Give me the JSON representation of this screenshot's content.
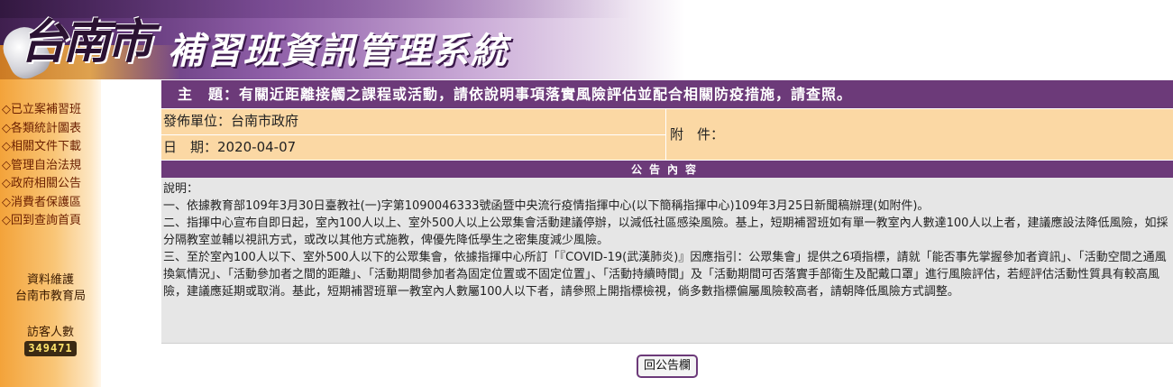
{
  "header": {
    "city_name": "台南市",
    "system_title": "補習班資訊管理系統"
  },
  "sidebar": {
    "items": [
      {
        "label": "◇已立案補習班"
      },
      {
        "label": "◇各類統計圖表"
      },
      {
        "label": "◇相關文件下載"
      },
      {
        "label": "◇管理自治法規"
      },
      {
        "label": "◇政府相關公告"
      },
      {
        "label": "◇消費者保護區"
      },
      {
        "label": "◇回到查詢首頁"
      }
    ],
    "maintainer_label": "資料維護",
    "maintainer_name": "台南市教育局",
    "visitor_label": "訪客人數",
    "visitor_count": "349471"
  },
  "notice": {
    "subject": "主　題：有關近距離接觸之課程或活動，請依說明事項落實風險評估並配合相關防疫措施，請查照。",
    "publisher": "發佈單位：台南市政府",
    "date": "日　期：2020-04-07",
    "attachment": "附　件：",
    "section_title": "公告內容",
    "body": [
      "說明：",
      "一、依據教育部109年3月30日臺教社(一)字第1090046333號函暨中央流行疫情指揮中心(以下簡稱指揮中心)109年3月25日新聞稿辦理(如附件)。",
      "二、指揮中心宣布自即日起，室內100人以上、室外500人以上公眾集會活動建議停辦，以減低社區感染風險。基上，短期補習班如有單一教室內人數達100人以上者，建議應設法降低風險，如採分隔教室並輔以視訊方式，或改以其他方式施教，俾優先降低學生之密集度減少風險。",
      "三、至於室內100人以下、室外500人以下的公眾集會，依據指揮中心所訂「『COVID-19(武漢肺炎)』因應指引：公眾集會」提供之6項指標，請就「能否事先掌握參加者資訊」、「活動空間之通風換氣情況」、「活動參加者之間的距離」、「活動期間參加者為固定位置或不固定位置」、「活動持續時間」及「活動期間可否落實手部衛生及配戴口罩」進行風險評估，若經評估活動性質具有較高風險，建議應延期或取消。基此，短期補習班單一教室內人數屬100人以下者，請參照上開指標檢視，倘多數指標偏屬風險較高者，請朝降低風險方式調整。"
    ],
    "back_button": "回公告欄"
  }
}
